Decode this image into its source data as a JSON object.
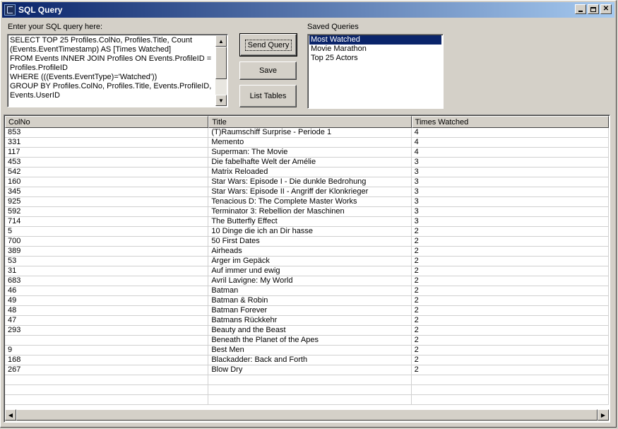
{
  "window": {
    "title": "SQL Query"
  },
  "query": {
    "label": "Enter your SQL query here:",
    "text": "SELECT TOP 25 Profiles.ColNo, Profiles.Title, Count\n(Events.EventTimestamp) AS [Times Watched]\nFROM Events INNER JOIN Profiles ON Events.ProfileID =\nProfiles.ProfileID\nWHERE (((Events.EventType)='Watched'))\nGROUP BY Profiles.ColNo, Profiles.Title, Events.ProfileID,\nEvents.UserID"
  },
  "buttons": {
    "send": "Send Query",
    "save": "Save",
    "list": "List Tables"
  },
  "saved": {
    "label": "Saved Queries",
    "items": [
      "Most Watched",
      "Movie Marathon",
      "Top 25 Actors"
    ]
  },
  "grid": {
    "columns": [
      "ColNo",
      "Title",
      "Times Watched"
    ],
    "rows": [
      [
        "853",
        "(T)Raumschiff Surprise - Periode 1",
        "4"
      ],
      [
        "331",
        "Memento",
        "4"
      ],
      [
        "117",
        "Superman: The Movie",
        "4"
      ],
      [
        "453",
        "Die fabelhafte Welt der Amélie",
        "3"
      ],
      [
        "542",
        "Matrix Reloaded",
        "3"
      ],
      [
        "160",
        "Star Wars: Episode I - Die dunkle Bedrohung",
        "3"
      ],
      [
        "345",
        "Star Wars: Episode II - Angriff der Klonkrieger",
        "3"
      ],
      [
        "925",
        "Tenacious D: The Complete Master Works",
        "3"
      ],
      [
        "592",
        "Terminator 3: Rebellion der Maschinen",
        "3"
      ],
      [
        "714",
        "The Butterfly Effect",
        "3"
      ],
      [
        "5",
        "10 Dinge die ich an Dir hasse",
        "2"
      ],
      [
        "700",
        "50 First Dates",
        "2"
      ],
      [
        "389",
        "Airheads",
        "2"
      ],
      [
        "53",
        "Ärger im Gepäck",
        "2"
      ],
      [
        "31",
        "Auf immer und ewig",
        "2"
      ],
      [
        "683",
        "Avril Lavigne: My World",
        "2"
      ],
      [
        "46",
        "Batman",
        "2"
      ],
      [
        "49",
        "Batman & Robin",
        "2"
      ],
      [
        "48",
        "Batman Forever",
        "2"
      ],
      [
        "47",
        "Batmans Rückkehr",
        "2"
      ],
      [
        "293",
        "Beauty and the Beast",
        "2"
      ],
      [
        "",
        "Beneath the Planet of the Apes",
        "2"
      ],
      [
        "9",
        "Best Men",
        "2"
      ],
      [
        "168",
        "Blackadder: Back and Forth",
        "2"
      ],
      [
        "267",
        "Blow Dry",
        "2"
      ]
    ]
  }
}
